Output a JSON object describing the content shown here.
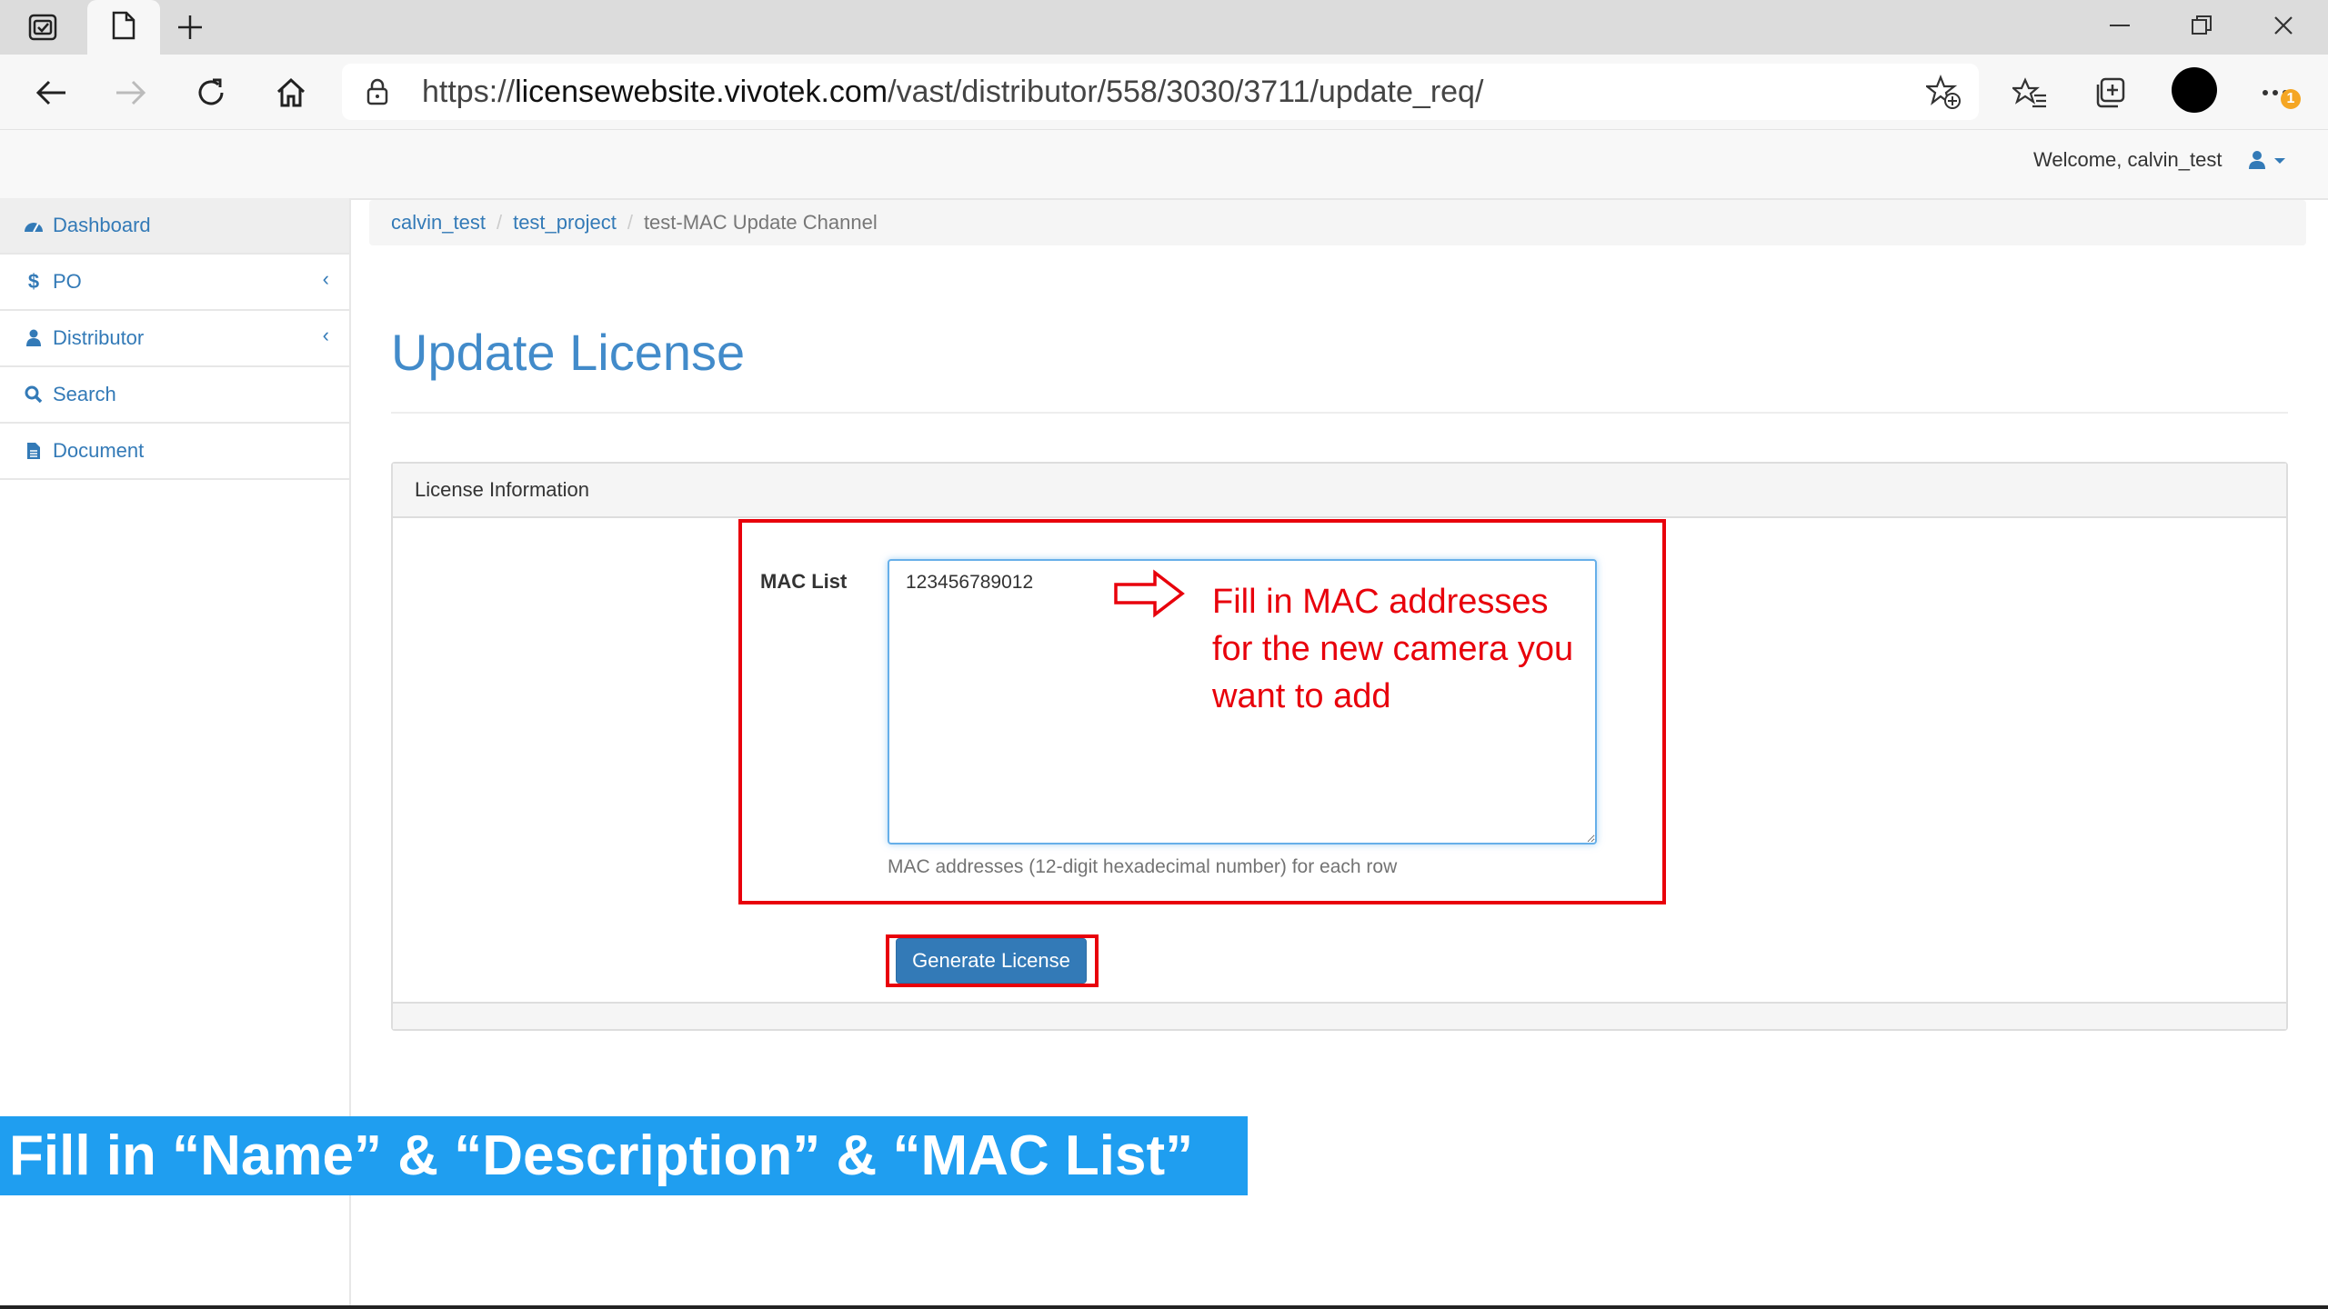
{
  "browser": {
    "url_prefix": "https://",
    "url_host": "licensewebsite.vivotek.com",
    "url_path": "/vast/distributor/558/3030/3711/update_req/",
    "notification_count": "1",
    "icons": {
      "tab_actions": "tab-actions-icon",
      "page_tab": "document-icon",
      "new_tab": "plus-icon",
      "minimize": "minimize-icon",
      "restore": "restore-icon",
      "close": "close-icon",
      "back": "arrow-left-icon",
      "forward": "arrow-right-icon",
      "refresh": "refresh-icon",
      "home": "home-icon",
      "lock": "lock-icon",
      "add_favorite": "star-add-icon",
      "favorites": "favorites-icon",
      "collections": "collections-icon",
      "more": "more-icon"
    }
  },
  "header": {
    "welcome": "Welcome, calvin_test",
    "user_icon": "user-icon",
    "caret_icon": "caret-down-icon"
  },
  "sidebar": {
    "items": [
      {
        "label": "Dashboard",
        "icon": "dashboard-icon",
        "active": true
      },
      {
        "label": "PO",
        "icon": "dollar-icon",
        "chevron": "‹"
      },
      {
        "label": "Distributor",
        "icon": "user-icon",
        "chevron": "‹"
      },
      {
        "label": "Search",
        "icon": "search-icon"
      },
      {
        "label": "Document",
        "icon": "file-icon"
      }
    ]
  },
  "breadcrumb": {
    "items": [
      "calvin_test",
      "test_project"
    ],
    "separator": "/",
    "current": "test-MAC Update Channel"
  },
  "page": {
    "title": "Update License"
  },
  "panel": {
    "heading": "License Information",
    "mac_label": "MAC List",
    "mac_value": "123456789012",
    "help_text": "MAC addresses (12-digit hexadecimal number) for each row",
    "button_label": "Generate License"
  },
  "annotation": {
    "note": "Fill in MAC addresses for the new camera you want to add",
    "banner": "Fill in “Name” & “Description” & “MAC List”"
  },
  "colors": {
    "link": "#337ab7",
    "title": "#428bca",
    "annotation_red": "#e8000b",
    "banner_blue": "#1f9ef0"
  }
}
